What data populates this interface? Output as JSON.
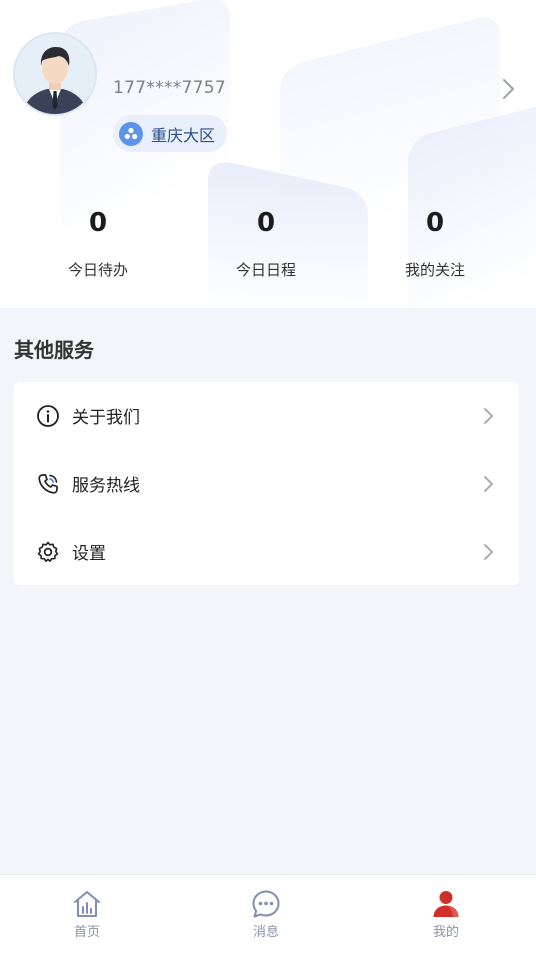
{
  "profile": {
    "phone": "177****7757",
    "region": "重庆大区"
  },
  "stats": [
    {
      "value": "0",
      "label": "今日待办"
    },
    {
      "value": "0",
      "label": "今日日程"
    },
    {
      "value": "0",
      "label": "我的关注"
    }
  ],
  "services": {
    "title": "其他服务",
    "items": [
      {
        "label": "关于我们",
        "icon": "info-icon"
      },
      {
        "label": "服务热线",
        "icon": "phone-icon"
      },
      {
        "label": "设置",
        "icon": "gear-icon"
      }
    ]
  },
  "tabbar": {
    "items": [
      {
        "label": "首页",
        "icon": "home-icon"
      },
      {
        "label": "消息",
        "icon": "chat-icon"
      },
      {
        "label": "我的",
        "icon": "user-icon",
        "active": true
      }
    ]
  },
  "colors": {
    "accent": "#d0302a",
    "region_bg": "#e9f0fb",
    "tab_icon": "#7f8fb0"
  }
}
